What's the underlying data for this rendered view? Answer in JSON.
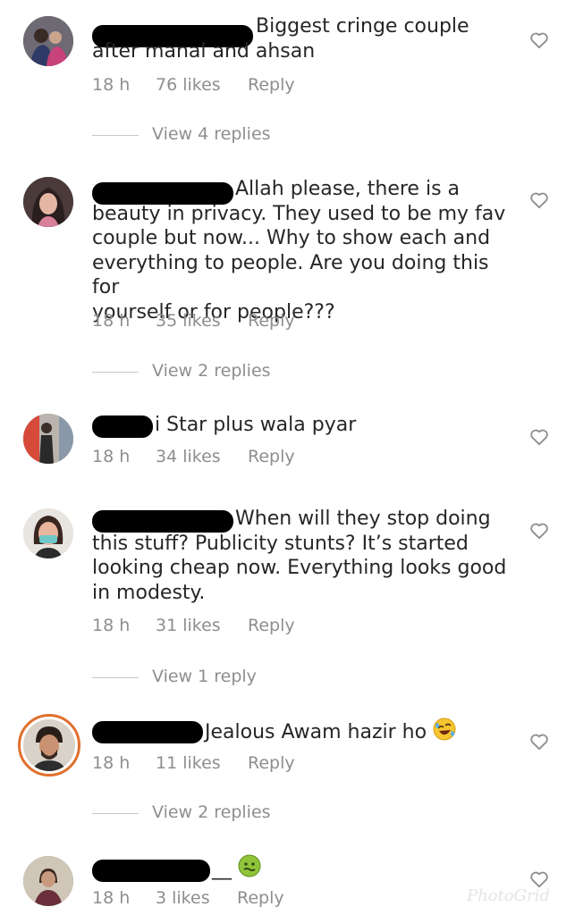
{
  "comments": [
    {
      "text": "Biggest cringe couple\nafter manal and ahsan",
      "time": "18 h",
      "likes": "76 likes",
      "reply": "Reply",
      "view_replies": "View 4 replies"
    },
    {
      "text": "Allah please, there is a\nbeauty in privacy. They used to be my fav\ncouple but now... Why to show each and\neverything to people. Are you doing this for\nyourself or for people???",
      "time": "18 h",
      "likes": "35 likes",
      "reply": "Reply",
      "view_replies": "View 2 replies"
    },
    {
      "text": "i Star plus wala pyar",
      "time": "18 h",
      "likes": "34 likes",
      "reply": "Reply"
    },
    {
      "text": "When will they stop doing\nthis stuff? Publicity stunts? It’s started\nlooking cheap now. Everything looks good\nin modesty.",
      "time": "18 h",
      "likes": "31 likes",
      "reply": "Reply",
      "view_replies": "View 1 reply"
    },
    {
      "text": "Jealous Awam hazir ho",
      "time": "18 h",
      "likes": "11 likes",
      "reply": "Reply",
      "view_replies": "View 2 replies"
    },
    {
      "text": "__",
      "time": "18 h",
      "likes": "3 likes",
      "reply": "Reply"
    }
  ],
  "icons": {
    "like": "heart-outline-icon",
    "laugh": "rolling-laughing-emoji",
    "sick": "nauseated-face-emoji"
  },
  "colors": {
    "text": "#262626",
    "secondary": "#8e8e8e",
    "story_ring": "#e0702e"
  },
  "watermark": "PhotoGrid"
}
